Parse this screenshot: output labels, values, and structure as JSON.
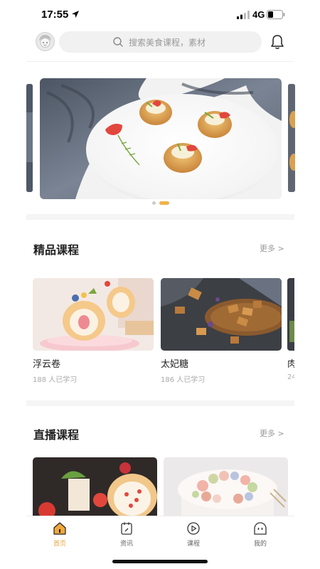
{
  "status_bar": {
    "time": "17:55",
    "network": "4G"
  },
  "search": {
    "placeholder": "搜索美食课程，素材"
  },
  "banner": {
    "slide_count": 2,
    "active_index": 1
  },
  "featured": {
    "title": "精品课程",
    "more_label": "更多 >",
    "courses": [
      {
        "name": "浮云卷",
        "learners": "188 人已学习"
      },
      {
        "name": "太妃糖",
        "learners": "186 人已学习"
      },
      {
        "name": "肉",
        "learners": "24"
      }
    ]
  },
  "live": {
    "title": "直播课程",
    "more_label": "更多 >"
  },
  "nav": {
    "items": [
      {
        "label": "首页",
        "icon": "home-icon",
        "active": true
      },
      {
        "label": "资讯",
        "icon": "news-icon",
        "active": false
      },
      {
        "label": "课程",
        "icon": "course-play-icon",
        "active": false
      },
      {
        "label": "我的",
        "icon": "profile-icon",
        "active": false
      }
    ]
  },
  "colors": {
    "accent": "#e8a33d",
    "search_bg": "#f1f1f1",
    "text_muted": "#999999"
  }
}
